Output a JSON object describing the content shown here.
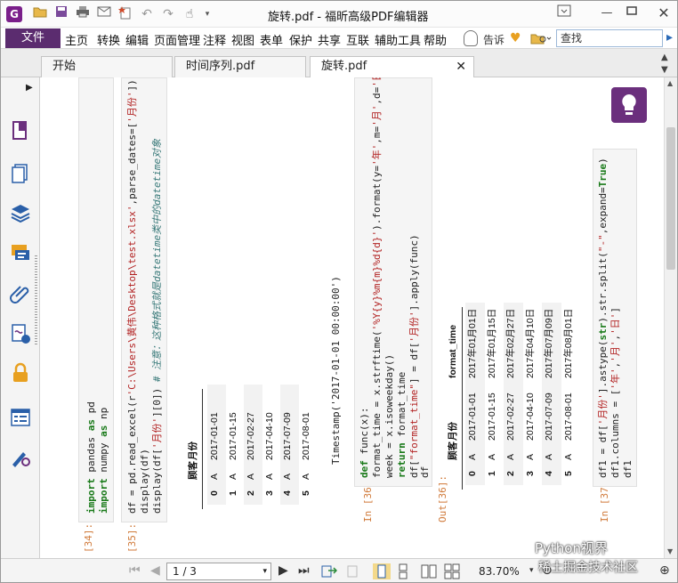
{
  "window": {
    "title": "旋转.pdf - 福昕高级PDF编辑器"
  },
  "menu": {
    "file": "文件",
    "items": [
      "主页",
      "转换",
      "编辑",
      "页面管理",
      "注释",
      "视图",
      "表单",
      "保护",
      "共享",
      "互联",
      "辅助工具",
      "帮助"
    ],
    "tell": "告诉",
    "search_placeholder": "查找"
  },
  "tabs": [
    {
      "label": "开始"
    },
    {
      "label": "时间序列.pdf"
    },
    {
      "label": "旋转.pdf"
    }
  ],
  "cells": {
    "c34": {
      "prompt": "[34]:",
      "line1a": "import",
      "line1b": " pandas ",
      "line1c": "as",
      "line1d": " pd",
      "line2a": "import",
      "line2b": " numpy ",
      "line2c": "as",
      "line2d": " np"
    },
    "c35": {
      "prompt": "[35]:",
      "line1a": "df = pd.read_excel(r",
      "line1b": "'C:\\Users\\黄伟\\Desktop\\test.xlsx'",
      "line1c": ",parse_dates=[",
      "line1d": "'月份'",
      "line1e": "])",
      "line2": "display(df)",
      "line3a": "display(df[",
      "line3b": "'月份'",
      "line3c": "][0])",
      "line3d": "    # 注意：这种格式就是datetime类中的datetime对象"
    },
    "out35": {
      "headers": [
        "",
        "顾客",
        "月份"
      ],
      "rows": [
        [
          "0",
          "A",
          "2017-01-01"
        ],
        [
          "1",
          "A",
          "2017-01-15"
        ],
        [
          "2",
          "A",
          "2017-02-27"
        ],
        [
          "3",
          "A",
          "2017-04-10"
        ],
        [
          "4",
          "A",
          "2017-07-09"
        ],
        [
          "5",
          "A",
          "2017-08-01"
        ]
      ],
      "timestamp": "Timestamp('2017-01-01 00:00:00')"
    },
    "c36": {
      "prompt": "In  [36]:",
      "l1a": "def",
      "l1b": " func(x):",
      "l2a": "    format_time = x.strftime(",
      "l2b": "'%Y{y}%m{m}%d{d}'",
      "l2c": ").format(y=",
      "l2d": "'年'",
      "l2e": ",m=",
      "l2f": "'月'",
      "l2g": ",d=",
      "l2h": "'日'",
      "l3": "    week = x.isoweekday()",
      "l4a": "    return",
      "l4b": " format_time",
      "l5a": "df[",
      "l5b": "\"format_time\"",
      "l5c": "] = df[",
      "l5d": "'月份'",
      "l5e": "].apply(func)",
      "l6": "df"
    },
    "out36": {
      "prompt": "Out[36]:",
      "headers": [
        "",
        "顾客",
        "月份",
        "format_time"
      ],
      "rows": [
        [
          "0",
          "A",
          "2017-01-01",
          "2017年01月01日"
        ],
        [
          "1",
          "A",
          "2017-01-15",
          "2017年01月15日"
        ],
        [
          "2",
          "A",
          "2017-02-27",
          "2017年02月27日"
        ],
        [
          "3",
          "A",
          "2017-04-10",
          "2017年04月10日"
        ],
        [
          "4",
          "A",
          "2017-07-09",
          "2017年07月09日"
        ],
        [
          "5",
          "A",
          "2017-08-01",
          "2017年08月01日"
        ]
      ]
    },
    "c37": {
      "prompt": "In  [37]:",
      "l1a": "df1 = df[",
      "l1b": "'月份'",
      "l1c": "].astype(",
      "l1d": "str",
      "l1e": ").str.split(",
      "l1f": "\"-\"",
      "l1g": ",expand=",
      "l1h": "True",
      "l1i": ")",
      "l2a": "df1.columns = [",
      "l2b": "'年'",
      "l2c": ",",
      "l2d": "'月'",
      "l2e": ",",
      "l2f": "'日'",
      "l2g": "]",
      "l3": "df1"
    }
  },
  "status": {
    "page": "1 / 3",
    "zoom": "83.70%"
  },
  "watermark": {
    "line1": "Python视界",
    "line2": "稀土掘金技术社区"
  },
  "colors": {
    "brand": "#5b2c6f",
    "accent": "#6b2f7d"
  }
}
